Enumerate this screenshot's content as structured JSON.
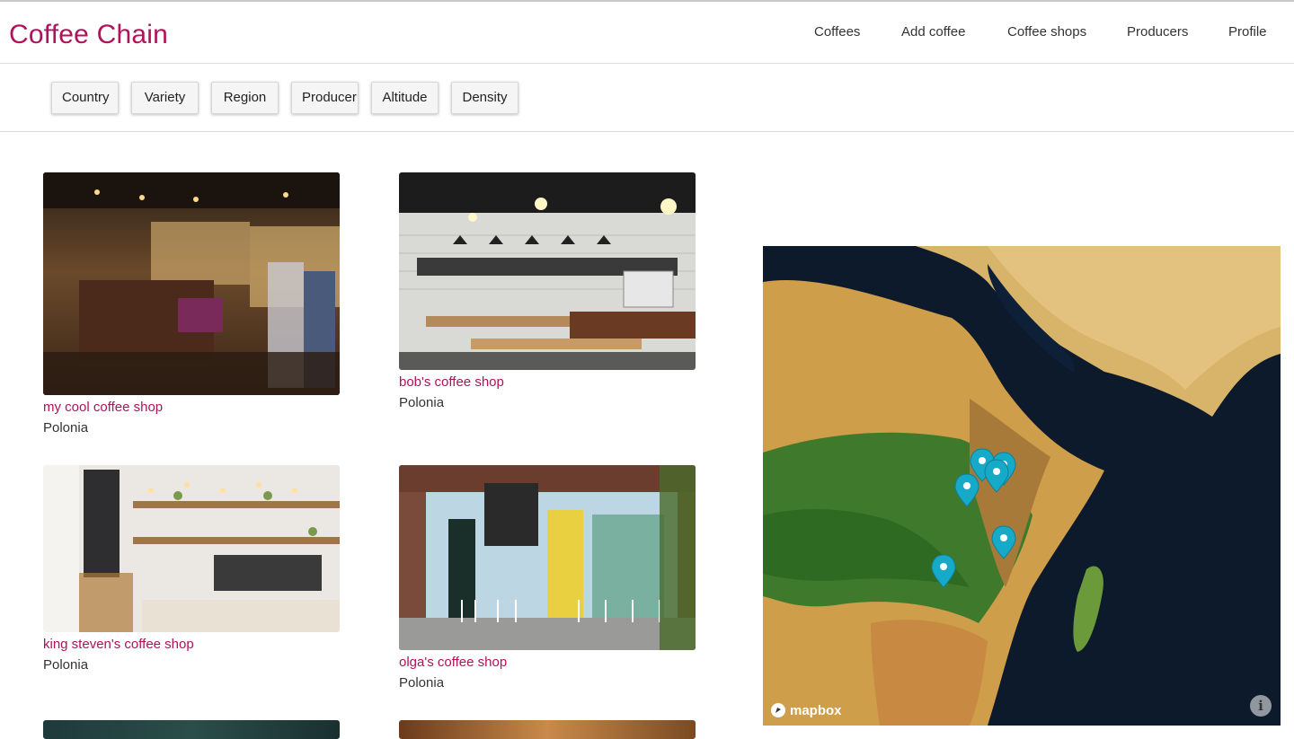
{
  "app": {
    "title": "Coffee Chain"
  },
  "nav": {
    "items": [
      "Coffees",
      "Add coffee",
      "Coffee shops",
      "Producers",
      "Profile"
    ]
  },
  "filters": [
    "Country",
    "Variety",
    "Region",
    "Producer",
    "Altitude",
    "Density"
  ],
  "shops": [
    {
      "name": "my cool coffee shop",
      "country": "Polonia"
    },
    {
      "name": "bob's coffee shop",
      "country": "Polonia"
    },
    {
      "name": "king steven's coffee shop",
      "country": "Polonia"
    },
    {
      "name": "olga's coffee shop",
      "country": "Polonia"
    }
  ],
  "map": {
    "attribution": "mapbox",
    "info_icon": "info-icon",
    "marker_color": "#17a9c8",
    "marker_count": 7
  },
  "colors": {
    "brand": "#b0125b",
    "marker": "#17a9c8"
  }
}
